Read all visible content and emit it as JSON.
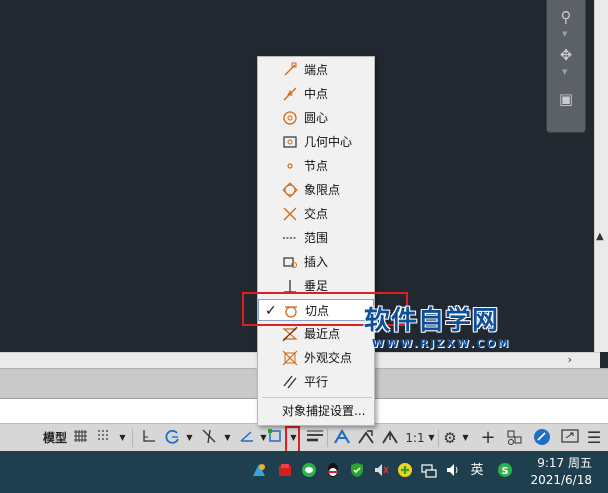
{
  "menu": {
    "items": [
      {
        "label": "端点",
        "icon": "endpoint-icon",
        "checked": false
      },
      {
        "label": "中点",
        "icon": "midpoint-icon",
        "checked": false
      },
      {
        "label": "圆心",
        "icon": "center-icon",
        "checked": false
      },
      {
        "label": "几何中心",
        "icon": "geometric-center-icon",
        "checked": false
      },
      {
        "label": "节点",
        "icon": "node-icon",
        "checked": false
      },
      {
        "label": "象限点",
        "icon": "quadrant-icon",
        "checked": false
      },
      {
        "label": "交点",
        "icon": "intersection-icon",
        "checked": false
      },
      {
        "label": "范围",
        "icon": "extension-icon",
        "checked": false
      },
      {
        "label": "插入",
        "icon": "insertion-icon",
        "checked": false
      },
      {
        "label": "垂足",
        "icon": "perpendicular-icon",
        "checked": false
      },
      {
        "label": "切点",
        "icon": "tangent-icon",
        "checked": true,
        "check_mark": "✓"
      },
      {
        "label": "最近点",
        "icon": "nearest-icon",
        "checked": false
      },
      {
        "label": "外观交点",
        "icon": "apparent-intersection-icon",
        "checked": false
      },
      {
        "label": "平行",
        "icon": "parallel-icon",
        "checked": false
      }
    ],
    "settings_label": "对象捕捉设置..."
  },
  "statusbar": {
    "model_label": "模型",
    "scale_label": "1:1"
  },
  "watermark": {
    "title": "软件自学网",
    "url": "WWW.RJZXW.COM"
  },
  "taskbar": {
    "ime_label": "英",
    "time": "9:17 周五",
    "date": "2021/6/18"
  },
  "colors": {
    "drawing_background": "#212830",
    "highlight_frame": "#e02020",
    "menu_icon": "#d06a1a",
    "watermark": "#0e4f9c",
    "taskbar": "#1f3f4e"
  }
}
